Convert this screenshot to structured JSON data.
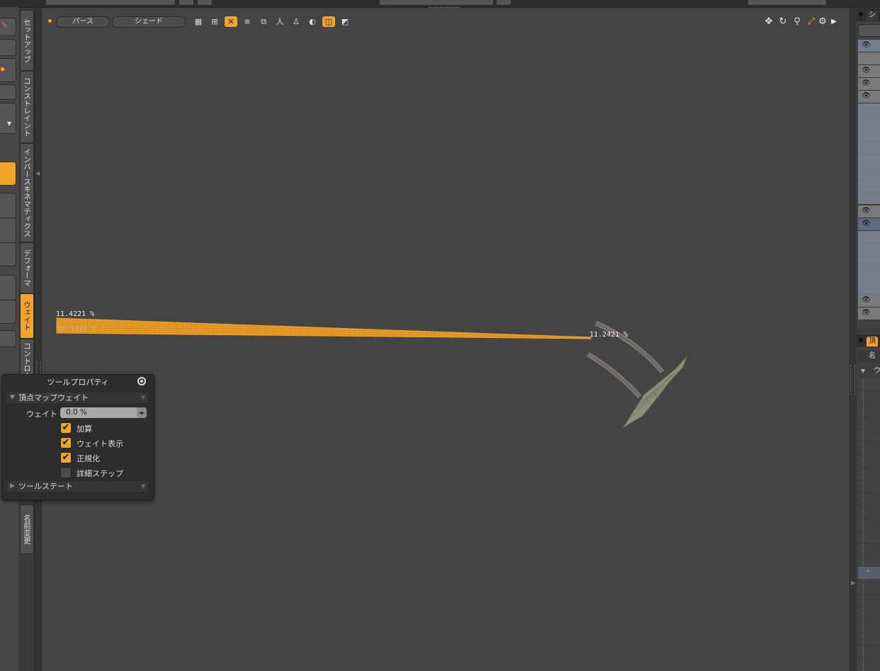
{
  "viewport": {
    "menus": [
      "パース",
      "シェード"
    ],
    "toolbar_icons": [
      "checker-icon",
      "grid-icon",
      "close-x-icon",
      "waves-icon",
      "layers-icon",
      "figure-icon",
      "person-icon",
      "half-shade-icon",
      "mirror-icon",
      "triangle-icon"
    ],
    "active_icons": [
      2,
      8
    ],
    "nav_icons": [
      "move-icon",
      "rotate-icon",
      "zoom-icon",
      "fit-icon",
      "gear-icon",
      "play-icon"
    ],
    "weight_labels": {
      "left_top": "11.4221 %",
      "left_bottom": "10.9129 %",
      "right": "11.2421 %"
    }
  },
  "vertical_tabs": [
    {
      "label": "セットアップ",
      "active": false
    },
    {
      "label": "コンストレイント",
      "active": false
    },
    {
      "label": "インバースキネマティクス",
      "active": false
    },
    {
      "label": "デフォーマ",
      "active": false
    },
    {
      "label": "ウェイト",
      "active": true
    },
    {
      "label": "コントロール",
      "active": false
    },
    {
      "label": "名前変更",
      "active": false
    }
  ],
  "right_panels": {
    "top_tab": "シ",
    "bottom_tab": "頂",
    "bottom_column": "名前",
    "bottom_group": "ウ"
  },
  "tool_properties": {
    "title": "ツールプロパティ",
    "section_main": "頂点マップウェイト",
    "weight_label": "ウェイト",
    "weight_value": "0.0 %",
    "options": [
      {
        "label": "加算",
        "checked": true
      },
      {
        "label": "ウェイト表示",
        "checked": true
      },
      {
        "label": "正規化",
        "checked": true
      },
      {
        "label": "詳細ステップ",
        "checked": false
      }
    ],
    "section_state": "ツールステート"
  },
  "colors": {
    "accent": "#f2a32a",
    "background": "#444444",
    "panel": "#2d2d2d"
  }
}
